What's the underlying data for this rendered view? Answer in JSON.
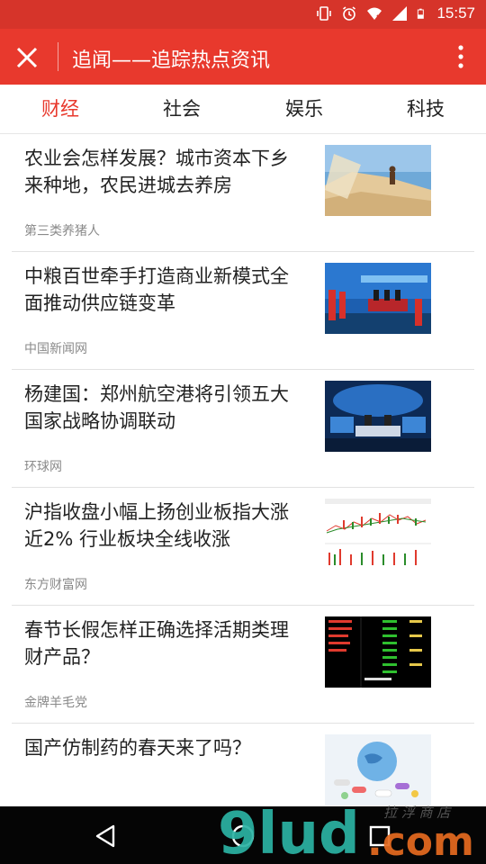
{
  "status_bar": {
    "time": "15:57"
  },
  "app_bar": {
    "title": "追闻——追踪热点资讯"
  },
  "tabs": [
    {
      "label": "财经",
      "active": true
    },
    {
      "label": "社会",
      "active": false
    },
    {
      "label": "娱乐",
      "active": false
    },
    {
      "label": "科技",
      "active": false
    }
  ],
  "articles": [
    {
      "headline": "农业会怎样发展？城市资本下乡来种地，农民进城去养房",
      "source": "第三类养猪人",
      "thumb": "grain-photo"
    },
    {
      "headline": "中粮百世牵手打造商业新模式全面推动供应链变革",
      "source": "中国新闻网",
      "thumb": "signing-ceremony-photo"
    },
    {
      "headline": "杨建国：郑州航空港将引领五大国家战略协调联动",
      "source": "环球网",
      "thumb": "tv-studio-photo"
    },
    {
      "headline": "沪指收盘小幅上扬创业板指大涨近2% 行业板块全线收涨",
      "source": "东方财富网",
      "thumb": "stock-chart-photo"
    },
    {
      "headline": "春节长假怎样正确选择活期类理财产品？",
      "source": "金牌羊毛党",
      "thumb": "stock-quote-screen-photo"
    },
    {
      "headline": "国产仿制药的春天来了吗？",
      "source": "",
      "thumb": "pills-globe-photo"
    }
  ],
  "watermark": {
    "brand": "9lud.com",
    "tagline": "拉 浮 商 店"
  },
  "colors": {
    "primary": "#e8392d",
    "status_bar": "#d6342a",
    "active_tab": "#e8392d"
  }
}
